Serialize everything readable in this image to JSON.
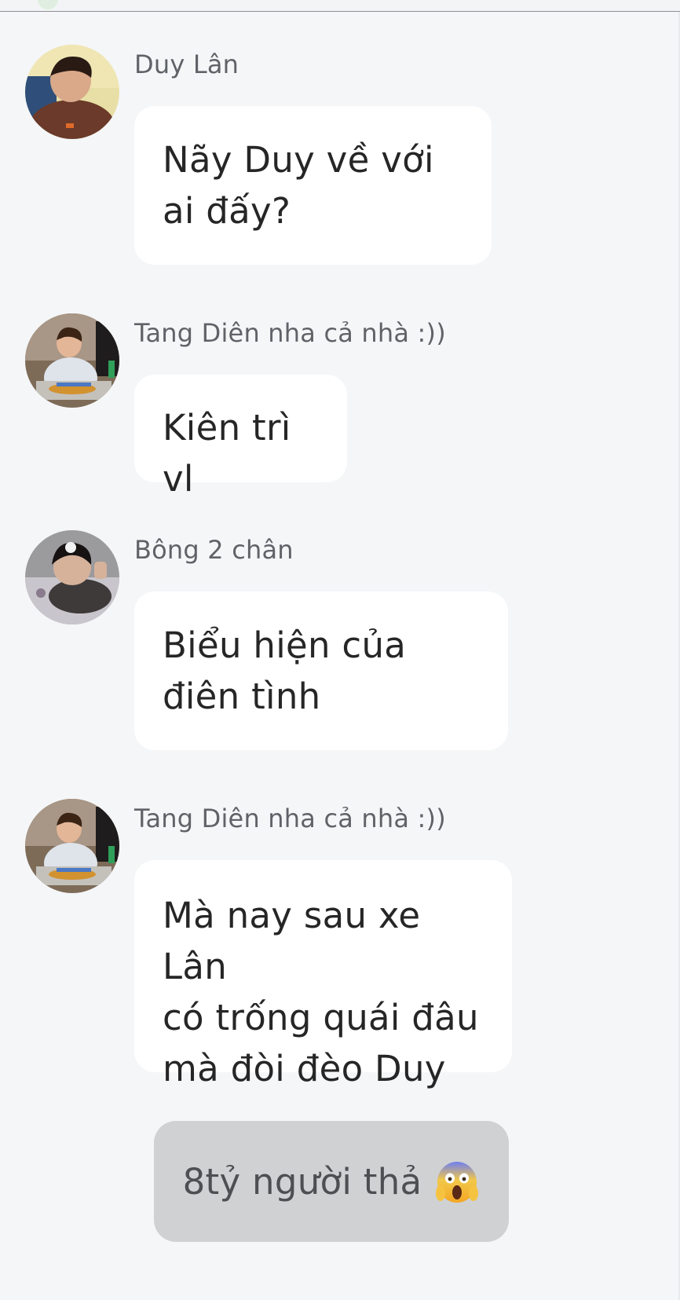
{
  "messages": [
    {
      "sender": "Duy Lân",
      "text": "Nãy Duy về với\nai đấy?",
      "avatar": "avatar-duy-lan"
    },
    {
      "sender": "Tang Diên nha cả nhà :))",
      "text": "Kiên trì vl",
      "avatar": "avatar-tang-dien"
    },
    {
      "sender": "Bông 2 chân",
      "text": "Biểu hiện của\nđiên tình",
      "avatar": "avatar-bong-2-chan"
    },
    {
      "sender": "Tang Diên nha cả nhà :))",
      "text": "Mà nay sau xe Lân\ncó trống quái đâu\nmà đòi đèo Duy",
      "avatar": "avatar-tang-dien"
    }
  ],
  "reaction": {
    "text": "8tỷ người thả",
    "emoji": "screaming-face-icon"
  },
  "colors": {
    "background": "#f5f6f8",
    "bubble": "#ffffff",
    "reaction_bg": "#d0d1d3",
    "sender_text": "#5f6368"
  }
}
